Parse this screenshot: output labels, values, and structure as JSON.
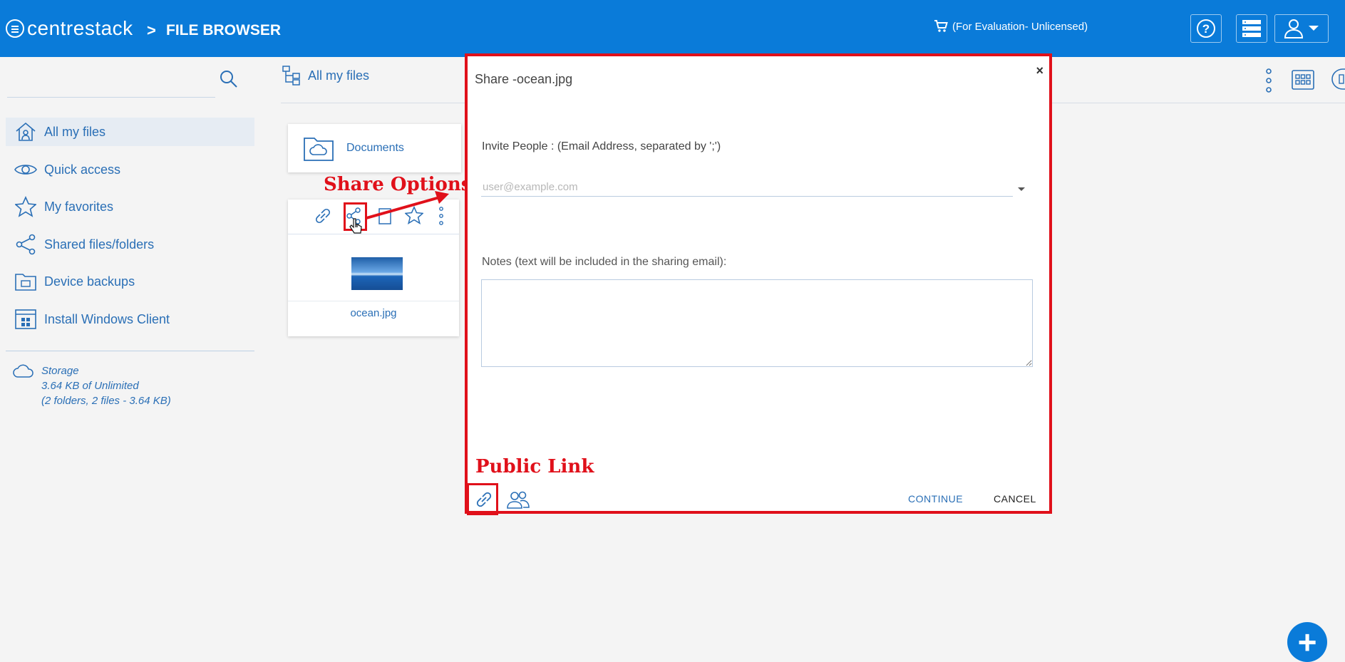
{
  "header": {
    "brand": "centrestack",
    "separator": ">",
    "page_title": "FILE BROWSER",
    "license_text": "(For Evaluation- Unlicensed)",
    "help_icon": "help-icon",
    "server_icon": "server-icon",
    "user_icon": "user-menu-icon"
  },
  "sidebar": {
    "search_placeholder": "",
    "items": [
      {
        "label": "All my files",
        "icon": "home-icon"
      },
      {
        "label": "Quick access",
        "icon": "eye-icon"
      },
      {
        "label": "My favorites",
        "icon": "star-icon"
      },
      {
        "label": "Shared files/folders",
        "icon": "share-icon"
      },
      {
        "label": "Device backups",
        "icon": "device-folder-icon"
      },
      {
        "label": "Install Windows Client",
        "icon": "windows-client-icon"
      }
    ],
    "storage": {
      "title": "Storage",
      "usage": "3.64 KB of Unlimited",
      "details": "(2 folders, 2 files - 3.64 KB)"
    }
  },
  "main": {
    "breadcrumb": "All my files",
    "folder": {
      "name": "Documents"
    },
    "file": {
      "name": "ocean.jpg"
    }
  },
  "annotations": {
    "share_options": "Share Options",
    "public_link": "Public Link"
  },
  "modal": {
    "title": "Share -ocean.jpg",
    "close": "×",
    "invite_label": "Invite People : (Email Address, separated by ';')",
    "email_placeholder": "user@example.com",
    "notes_label": "Notes (text will be included in the sharing email):",
    "continue": "CONTINUE",
    "cancel": "CANCEL"
  },
  "fab": "+",
  "colors": {
    "header": "#0a7bd9",
    "accent": "#2a6fb6",
    "annotation": "#e0101a",
    "background": "#f4f4f4"
  }
}
